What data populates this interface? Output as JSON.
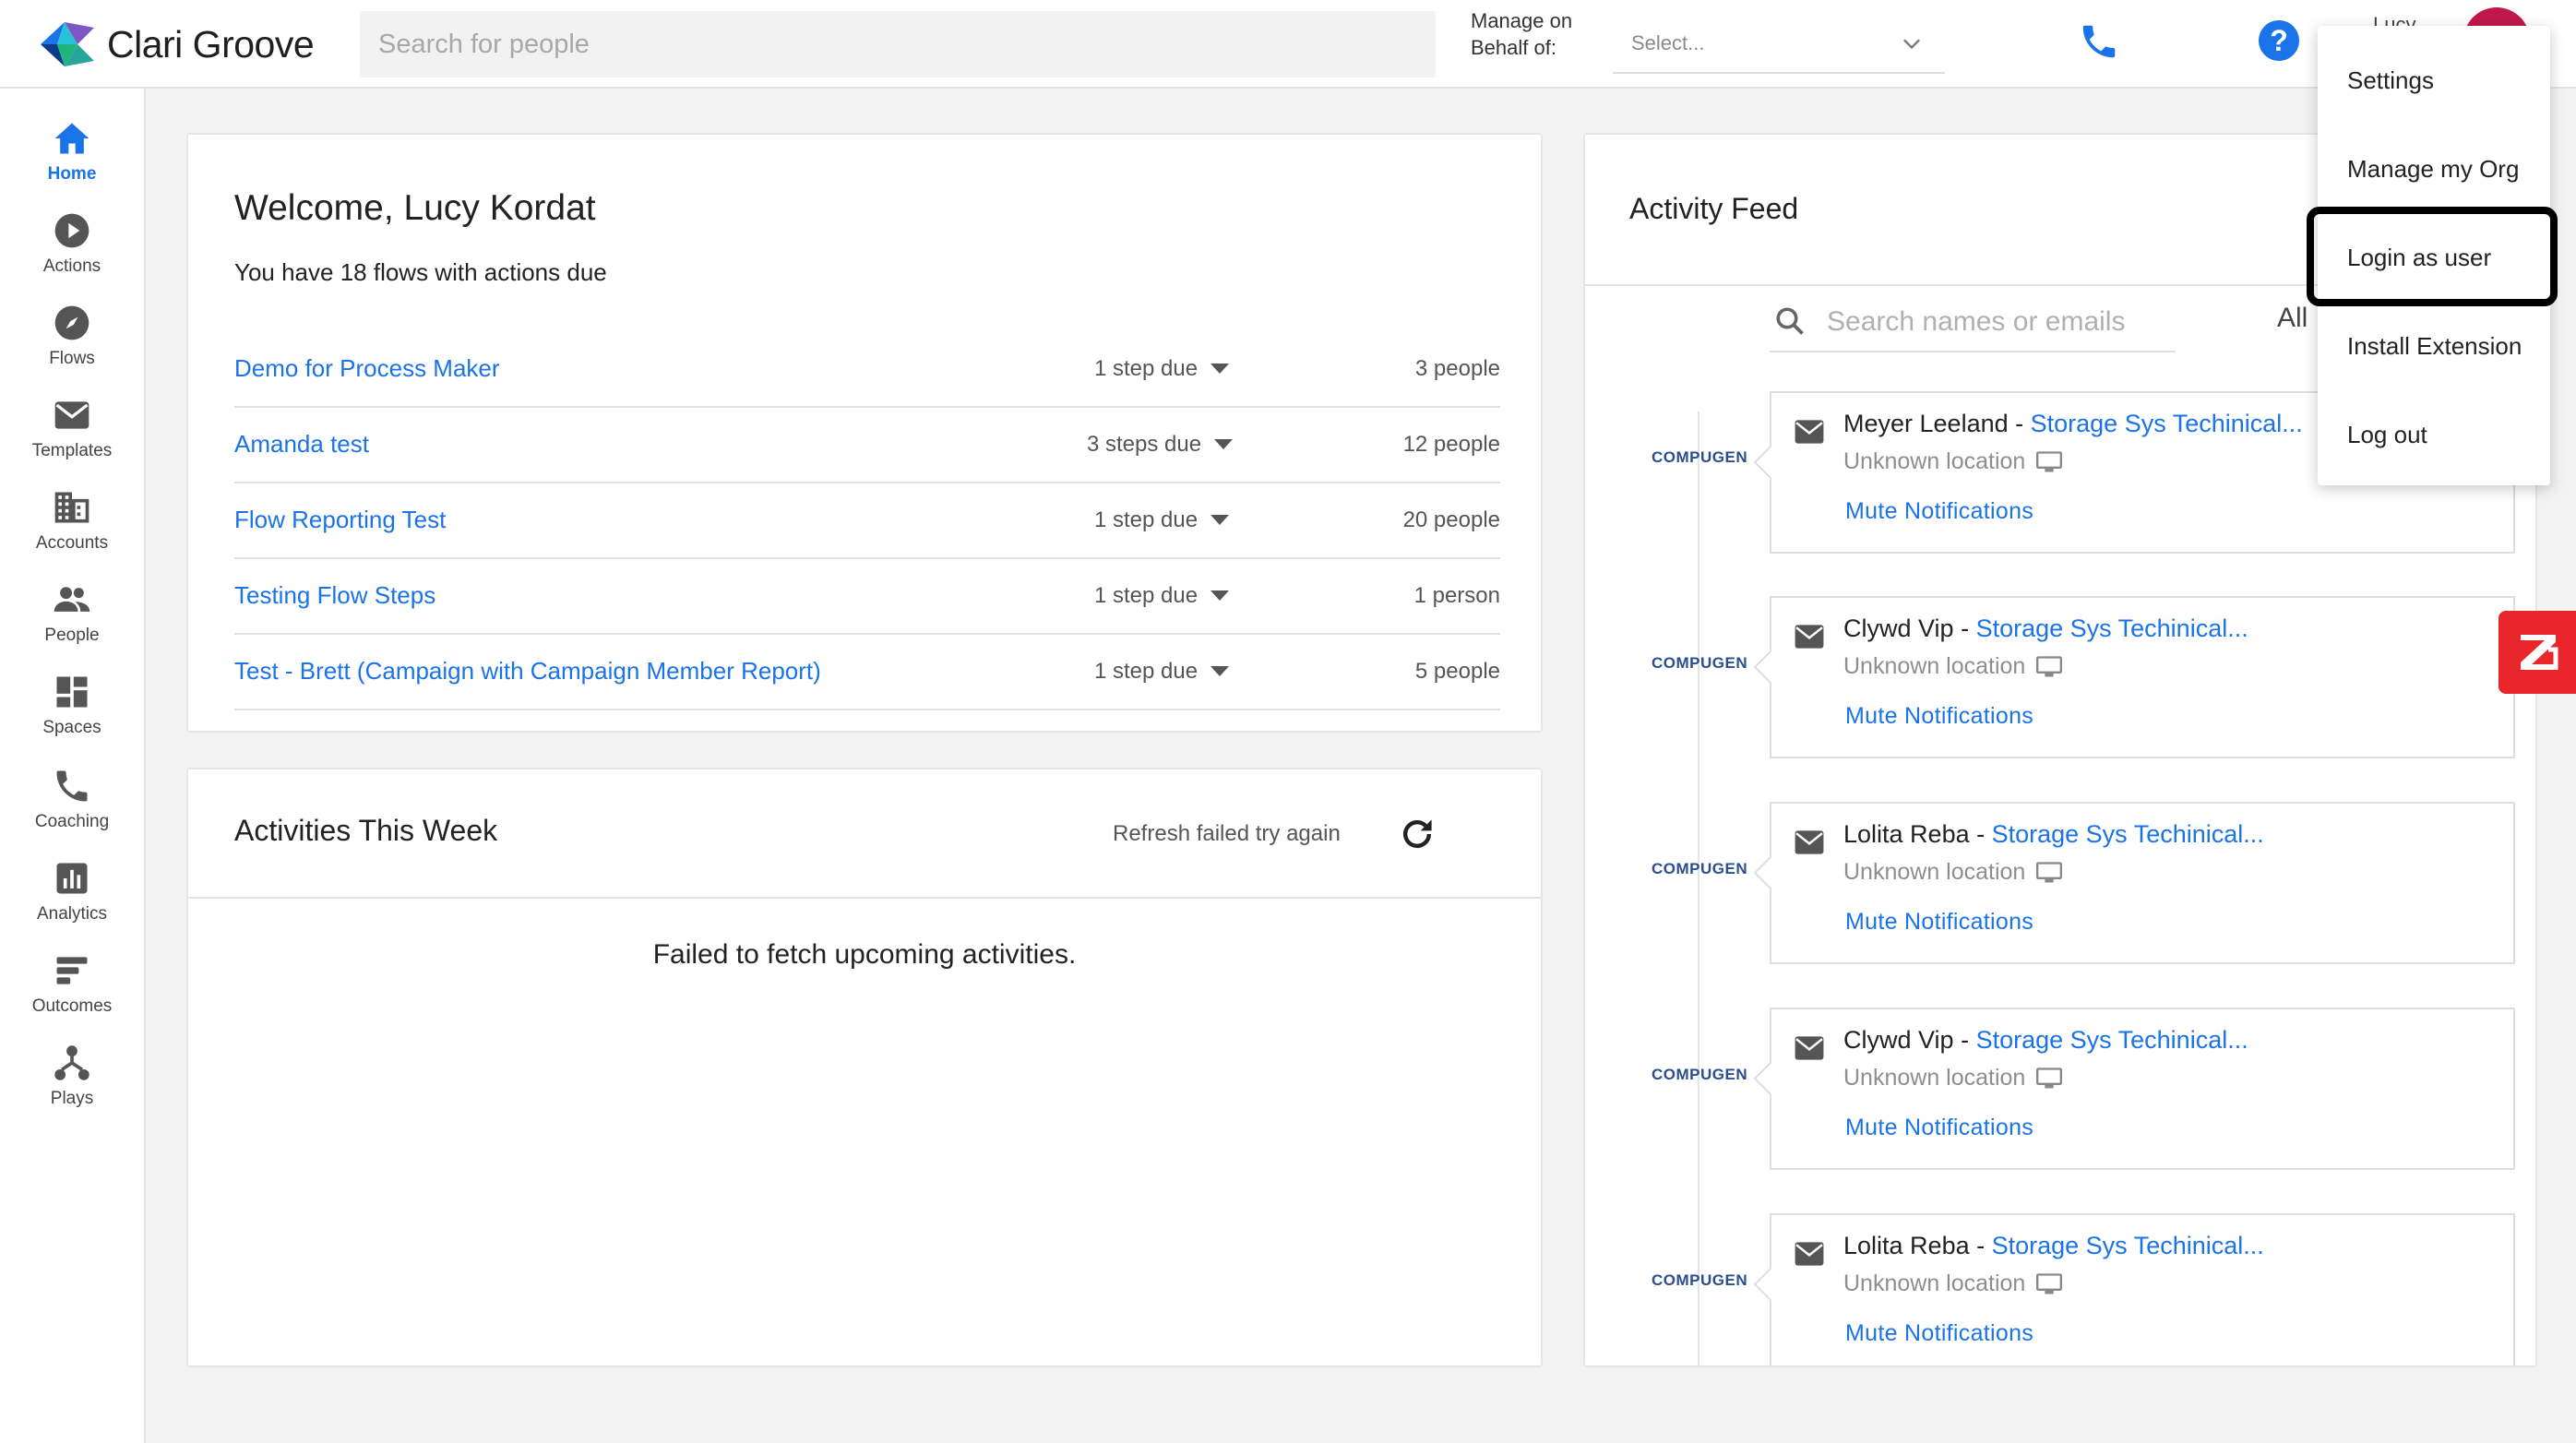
{
  "app": {
    "logo_text": "Clari Groove",
    "accent": "#1a73e8",
    "alert_accent": "#e8262b"
  },
  "topbar": {
    "search_placeholder": "Search for people",
    "behalf_label": "Manage on Behalf of:",
    "behalf_select_value": "Select...",
    "user_name": "Lucy",
    "icons": [
      "phone-icon",
      "help-icon",
      "chevron-down-icon"
    ]
  },
  "sidebar": {
    "items": [
      {
        "label": "Home",
        "icon": "home-icon",
        "active": true
      },
      {
        "label": "Actions",
        "icon": "play-circle-icon"
      },
      {
        "label": "Flows",
        "icon": "compass-icon"
      },
      {
        "label": "Templates",
        "icon": "envelope-icon"
      },
      {
        "label": "Accounts",
        "icon": "building-icon"
      },
      {
        "label": "People",
        "icon": "people-icon"
      },
      {
        "label": "Spaces",
        "icon": "dashboard-icon"
      },
      {
        "label": "Coaching",
        "icon": "phone-icon"
      },
      {
        "label": "Analytics",
        "icon": "bar-chart-icon"
      },
      {
        "label": "Outcomes",
        "icon": "outcomes-icon"
      },
      {
        "label": "Plays",
        "icon": "plays-icon"
      }
    ]
  },
  "welcome": {
    "title": "Welcome, Lucy Kordat",
    "subtitle": "You have 18 flows with actions due",
    "flows": [
      {
        "name": "Demo for Process Maker",
        "due": "1 step due",
        "people": "3 people"
      },
      {
        "name": "Amanda test",
        "due": "3 steps due",
        "people": "12 people"
      },
      {
        "name": "Flow Reporting Test",
        "due": "1 step due",
        "people": "20 people"
      },
      {
        "name": "Testing Flow Steps",
        "due": "1 step due",
        "people": "1 person"
      },
      {
        "name": "Test - Brett (Campaign with Campaign Member Report)",
        "due": "1 step due",
        "people": "5 people"
      }
    ]
  },
  "activities": {
    "title": "Activities This Week",
    "refresh_text": "Refresh failed try again",
    "error": "Failed to fetch upcoming activities."
  },
  "feed": {
    "title": "Activity Feed",
    "search_placeholder": "Search names or emails",
    "filter_label": "All",
    "company_logo": "COMPUGEN",
    "items": [
      {
        "name": "Meyer Leeland",
        "sep": " - ",
        "account": "Storage Sys Techinical...",
        "location": "Unknown location",
        "action": "Mute Notifications"
      },
      {
        "name": "Clywd Vip",
        "sep": " - ",
        "account": "Storage Sys Techinical...",
        "location": "Unknown location",
        "action": "Mute Notifications"
      },
      {
        "name": "Lolita Reba",
        "sep": " - ",
        "account": "Storage Sys Techinical...",
        "location": "Unknown location",
        "action": "Mute Notifications"
      },
      {
        "name": "Clywd Vip",
        "sep": " - ",
        "account": "Storage Sys Techinical...",
        "location": "Unknown location",
        "action": "Mute Notifications"
      },
      {
        "name": "Lolita Reba",
        "sep": " - ",
        "account": "Storage Sys Techinical...",
        "location": "Unknown location",
        "action": "Mute Notifications"
      }
    ]
  },
  "user_menu": {
    "items": [
      "Settings",
      "Manage my Org",
      "Login as user",
      "Install Extension",
      "Log out"
    ],
    "highlighted": "Login as user"
  }
}
